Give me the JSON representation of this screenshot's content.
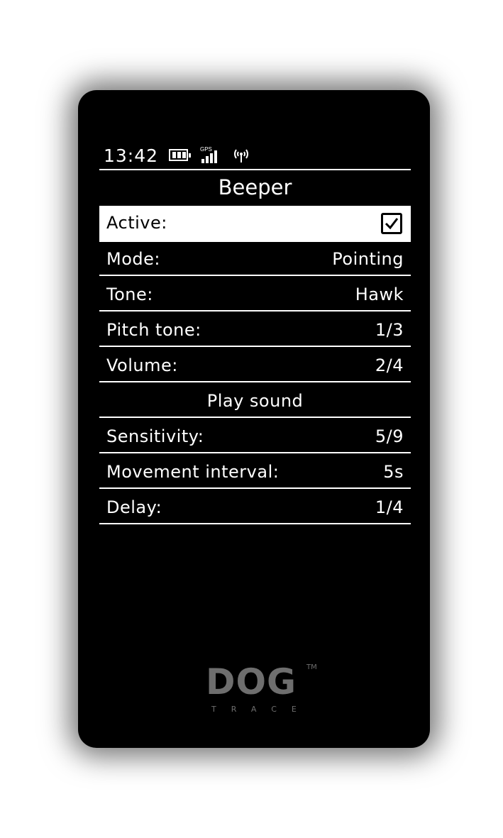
{
  "status_bar": {
    "time": "13:42",
    "battery_icon": "battery-icon",
    "gps_label": "GPS",
    "gps_icon": "gps-signal-icon",
    "antenna_icon": "radio-antenna-icon"
  },
  "screen": {
    "title": "Beeper"
  },
  "settings": {
    "active": {
      "label": "Active:",
      "checked": true,
      "icon": "checkbox-checked-icon"
    },
    "mode": {
      "label": "Mode:",
      "value": "Pointing"
    },
    "tone": {
      "label": "Tone:",
      "value": "Hawk"
    },
    "pitch_tone": {
      "label": "Pitch tone:",
      "value": "1/3"
    },
    "volume": {
      "label": "Volume:",
      "value": "2/4"
    },
    "play_sound": {
      "label": "Play sound"
    },
    "sensitivity": {
      "label": "Sensitivity:",
      "value": "5/9"
    },
    "movement_interval": {
      "label": "Movement interval:",
      "value": "5s"
    },
    "delay": {
      "label": "Delay:",
      "value": "1/4"
    }
  },
  "logo": {
    "brand": "DOG",
    "trademark": "TM",
    "sub": "TRACE"
  },
  "colors": {
    "background": "#000000",
    "text": "#ffffff",
    "highlight": "#ffffff",
    "logo": "#6e6e6e"
  }
}
